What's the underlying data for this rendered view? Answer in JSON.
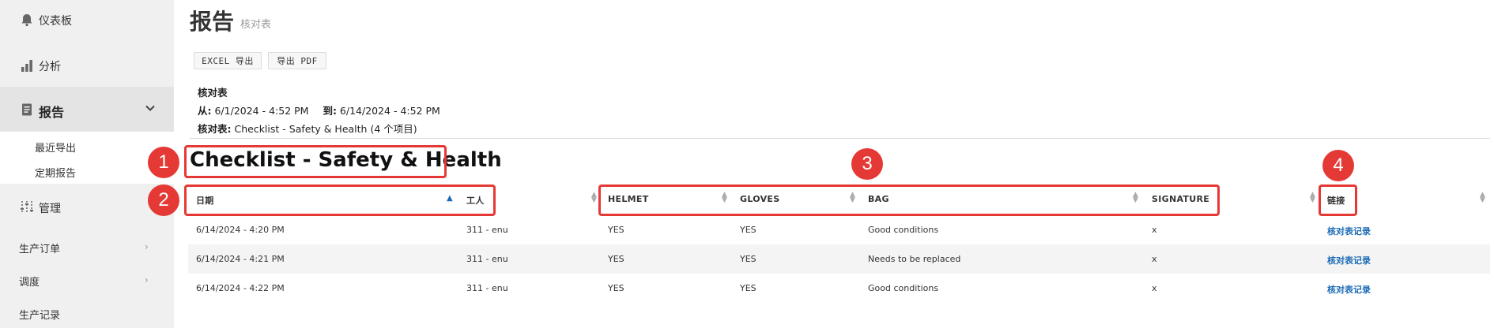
{
  "sidebar": {
    "dashboard": "仪表板",
    "analytics": "分析",
    "reports": "报告",
    "recent_exports": "最近导出",
    "scheduled_reports": "定期报告",
    "manage": "管理",
    "production_orders": "生产订单",
    "scheduling": "调度",
    "production_records": "生产记录"
  },
  "page": {
    "title": "报告",
    "subtitle": "核对表",
    "export_excel": "EXCEL 导出",
    "export_pdf": "导出 PDF"
  },
  "info": {
    "heading": "核对表",
    "from_label": "从:",
    "from_value": "6/1/2024 - 4:52 PM",
    "to_label": "到:",
    "to_value": "6/14/2024 - 4:52 PM",
    "checklist_label": "核对表:",
    "checklist_value": "Checklist - Safety & Health (4 个项目)"
  },
  "checklist_title": "Checklist - Safety & Health",
  "table": {
    "headers": [
      "日期",
      "工人",
      "HELMET",
      "GLOVES",
      "BAG",
      "SIGNATURE",
      "链接"
    ],
    "rows": [
      [
        "6/14/2024 - 4:20 PM",
        "311 - enu",
        "YES",
        "YES",
        "Good conditions",
        "x",
        "核对表记录"
      ],
      [
        "6/14/2024 - 4:21 PM",
        "311 - enu",
        "YES",
        "YES",
        "Needs to be replaced",
        "x",
        "核对表记录"
      ],
      [
        "6/14/2024 - 4:22 PM",
        "311 - enu",
        "YES",
        "YES",
        "Good conditions",
        "x",
        "核对表记录"
      ]
    ]
  },
  "annotations": [
    "1",
    "2",
    "3",
    "4"
  ],
  "colors": {
    "annotation": "#e53935",
    "link": "#1b6ab5",
    "sidebar_bg": "#f0f0f0"
  }
}
